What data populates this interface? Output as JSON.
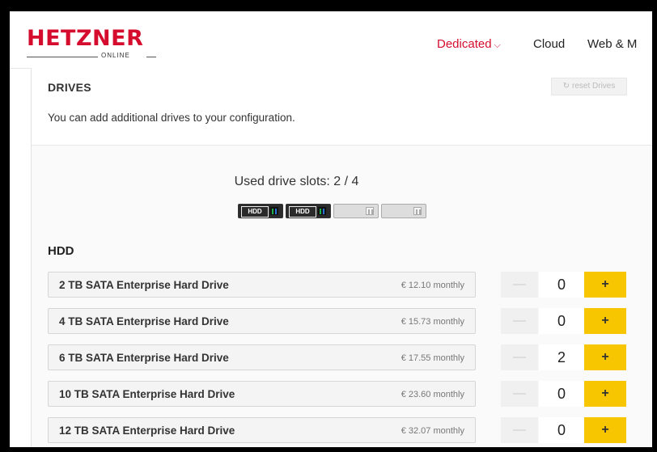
{
  "header": {
    "logo_main": "HETZNER",
    "logo_sub": "ONLINE",
    "nav": [
      "Dedicated",
      "Cloud",
      "Web & M"
    ],
    "nav_chevron": "⌵"
  },
  "drives": {
    "title": "DRIVES",
    "reset_label": "reset Drives",
    "description": "You can add additional drives to your configuration.",
    "slots_label": "Used drive slots: 2 / 4",
    "slots": [
      {
        "label": "HDD",
        "filled": true
      },
      {
        "label": "HDD",
        "filled": true
      },
      {
        "label": "",
        "filled": false
      },
      {
        "label": "",
        "filled": false
      }
    ],
    "group_title": "HDD",
    "items": [
      {
        "name": "2 TB SATA Enterprise Hard Drive",
        "price": "€ 12.10 monthly",
        "qty": "0"
      },
      {
        "name": "4 TB SATA Enterprise Hard Drive",
        "price": "€ 15.73 monthly",
        "qty": "0"
      },
      {
        "name": "6 TB SATA Enterprise Hard Drive",
        "price": "€ 17.55 monthly",
        "qty": "2"
      },
      {
        "name": "10 TB SATA Enterprise Hard Drive",
        "price": "€ 23.60 monthly",
        "qty": "0"
      },
      {
        "name": "12 TB SATA Enterprise Hard Drive",
        "price": "€ 32.07 monthly",
        "qty": "0"
      }
    ],
    "minus_label": "—",
    "plus_label": "+"
  },
  "colors": {
    "brand": "#d50c2d",
    "plus_button": "#f7c600"
  }
}
